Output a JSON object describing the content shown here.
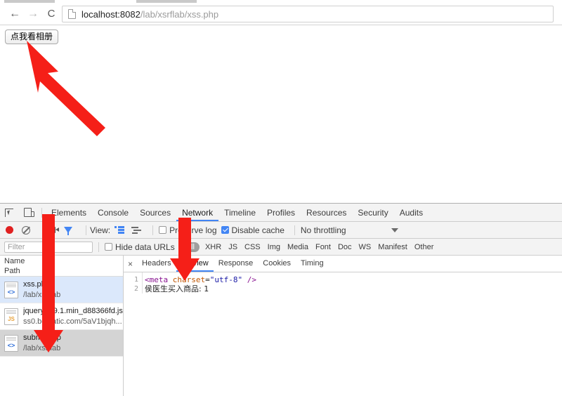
{
  "browser": {
    "back_icon": "arrow-left-icon",
    "forward_icon": "arrow-right-icon",
    "reload_icon": "reload-icon",
    "back_glyph": "←",
    "forward_glyph": "→",
    "reload_glyph": "C",
    "url_host": "localhost:8082",
    "url_path": "/lab/xsrflab/xss.php",
    "page_icon": "document-icon"
  },
  "page": {
    "album_button_label": "点我看相册"
  },
  "devtools": {
    "tabs": [
      {
        "label": "Elements",
        "active": false
      },
      {
        "label": "Console",
        "active": false
      },
      {
        "label": "Sources",
        "active": false
      },
      {
        "label": "Network",
        "active": true
      },
      {
        "label": "Timeline",
        "active": false
      },
      {
        "label": "Profiles",
        "active": false
      },
      {
        "label": "Resources",
        "active": false
      },
      {
        "label": "Security",
        "active": false
      },
      {
        "label": "Audits",
        "active": false
      }
    ],
    "toolbar": {
      "record_icon": "record-icon",
      "clear_icon": "clear-icon",
      "camera_icon": "camera-icon",
      "filter_icon": "filter-funnel-icon",
      "view_label": "View:",
      "view_list_icon": "list-view-icon",
      "view_waterfall_icon": "waterfall-view-icon",
      "preserve_log_label": "Preserve log",
      "preserve_log_checked": false,
      "disable_cache_label": "Disable cache",
      "disable_cache_checked": true,
      "throttling_value": "No throttling",
      "throttling_caret_icon": "chevron-down-icon"
    },
    "filterbar": {
      "filter_placeholder": "Filter",
      "filter_value": "",
      "hide_data_urls_label": "Hide data URLs",
      "hide_data_urls_checked": false,
      "types": [
        {
          "label": "All",
          "selected": true
        },
        {
          "label": "XHR",
          "selected": false
        },
        {
          "label": "JS",
          "selected": false
        },
        {
          "label": "CSS",
          "selected": false
        },
        {
          "label": "Img",
          "selected": false
        },
        {
          "label": "Media",
          "selected": false
        },
        {
          "label": "Font",
          "selected": false
        },
        {
          "label": "Doc",
          "selected": false
        },
        {
          "label": "WS",
          "selected": false
        },
        {
          "label": "Manifest",
          "selected": false
        },
        {
          "label": "Other",
          "selected": false
        }
      ]
    },
    "requests": {
      "col_name": "Name",
      "col_path": "Path",
      "rows": [
        {
          "name": "xss.php",
          "path": "/lab/xsrflab",
          "icon": "document-code-icon",
          "badge": "<>",
          "state": "highlighted"
        },
        {
          "name": "jquery-1.9.1.min_d88366fd.js",
          "path": "ss0.bdstatic.com/5aV1bjqh...",
          "icon": "javascript-file-icon",
          "badge": "JS",
          "state": "normal"
        },
        {
          "name": "submit.php",
          "path": "/lab/xsrflab",
          "icon": "document-code-icon",
          "badge": "<>",
          "state": "selected"
        }
      ]
    },
    "detail": {
      "close_icon": "close-icon",
      "tabs": [
        {
          "label": "Headers",
          "active": false
        },
        {
          "label": "Preview",
          "active": true
        },
        {
          "label": "Response",
          "active": false
        },
        {
          "label": "Cookies",
          "active": false
        },
        {
          "label": "Timing",
          "active": false
        }
      ],
      "code": [
        {
          "number": "1",
          "parts": [
            {
              "text": "<meta",
              "type": "tag"
            },
            {
              "text": " charset",
              "type": "attr"
            },
            {
              "text": "=",
              "type": "plain"
            },
            {
              "text": "\"utf-8\"",
              "type": "val"
            },
            {
              "text": " />",
              "type": "tag"
            }
          ]
        },
        {
          "number": "2",
          "parts": [
            {
              "text": "侯医生买入商品: 1",
              "type": "cjk"
            }
          ]
        }
      ]
    }
  },
  "annotations": {
    "color": "#f51f18",
    "arrows": [
      {
        "name": "arrow-to-album-button",
        "label": ""
      },
      {
        "name": "arrow-to-network-tab",
        "label": ""
      },
      {
        "name": "arrow-to-submit-request",
        "label": ""
      },
      {
        "name": "arrow-to-preview-tab",
        "label": ""
      }
    ]
  }
}
